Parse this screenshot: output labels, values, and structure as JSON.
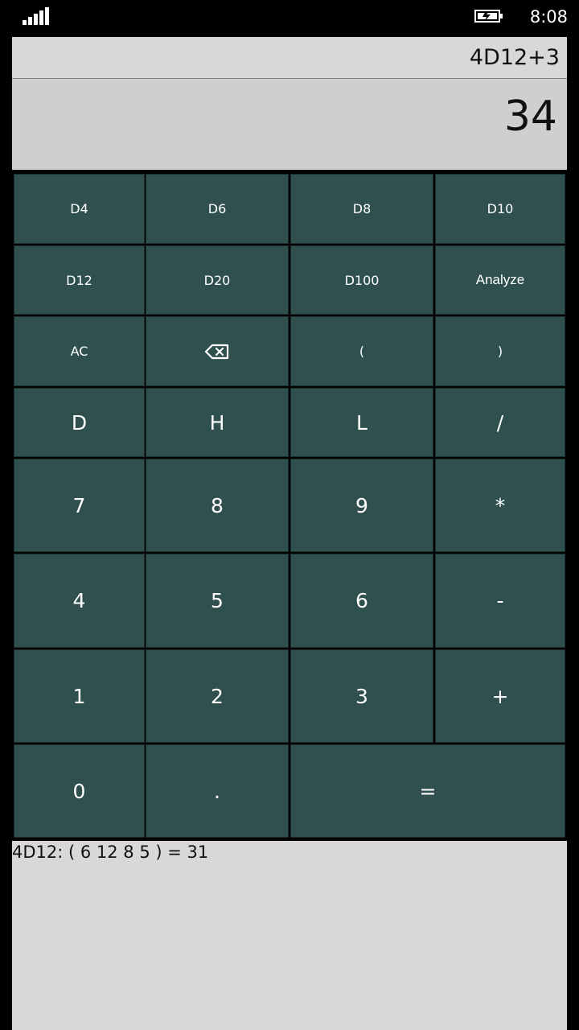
{
  "status_bar": {
    "signal_icon": "signal-strength-icon",
    "battery_icon": "battery-charging-icon",
    "time": "8:08"
  },
  "display": {
    "expression": "4D12+3",
    "result": "34"
  },
  "keypad": {
    "rows": [
      [
        "D4",
        "D6",
        "D8",
        "D10"
      ],
      [
        "D12",
        "D20",
        "D100",
        "Analyze"
      ],
      [
        "AC",
        "backspace-icon",
        "(",
        ")"
      ],
      [
        "D",
        "H",
        "L",
        "/"
      ],
      [
        "7",
        "8",
        "9",
        "*"
      ],
      [
        "4",
        "5",
        "6",
        "-"
      ],
      [
        "1",
        "2",
        "3",
        "+"
      ],
      [
        "0",
        ".",
        "="
      ]
    ]
  },
  "history": {
    "lines": [
      "4D12: ( 6 12 8 5 ) = 31"
    ]
  },
  "colors": {
    "key_background": "#305050",
    "display_background": "#d8d8d8",
    "result_background": "#cfcfcf"
  }
}
